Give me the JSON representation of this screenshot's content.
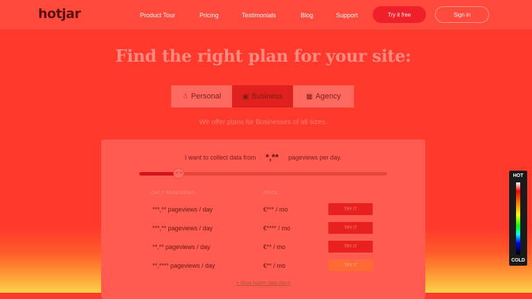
{
  "nav": {
    "logo": "hotjar",
    "links": [
      "Product Tour",
      "Pricing",
      "Testimonials",
      "Blog",
      "Support"
    ],
    "try_label": "Try it free",
    "signin_label": "Sign in"
  },
  "hero": {
    "headline": "Find the right plan for your site:",
    "tabs": [
      {
        "label": "Personal",
        "icon": "person-icon"
      },
      {
        "label": "Business",
        "icon": "briefcase-icon"
      },
      {
        "label": "Agency",
        "icon": "building-icon"
      }
    ],
    "active_tab": "Business",
    "subtitle": "We offer plans for Businesses of all sizes."
  },
  "pricing": {
    "collect_prefix": "I want to collect data from",
    "collect_value": "*,**",
    "collect_suffix": "pageviews per day.",
    "slider_handle": "< >",
    "slider_fraction": 0.16,
    "col_headers": [
      "DAILY PAGEVIEWS",
      "PRICE"
    ],
    "rows": [
      {
        "pageviews": "***,** pageviews / day",
        "price": "€*** / mo",
        "action": "TRY IT"
      },
      {
        "pageviews": "***,** pageviews / day",
        "price": "€**** / mo",
        "action": "TRY IT"
      },
      {
        "pageviews": "**,** pageviews / day",
        "price": "€** / mo",
        "action": "TRY IT"
      },
      {
        "pageviews": "**,**** pageviews / day",
        "price": "€** / mo",
        "action": "TRY IT"
      }
    ],
    "show_more": "+ show higher data plans"
  },
  "legend": {
    "hot": "HOT",
    "cold": "COLD"
  }
}
